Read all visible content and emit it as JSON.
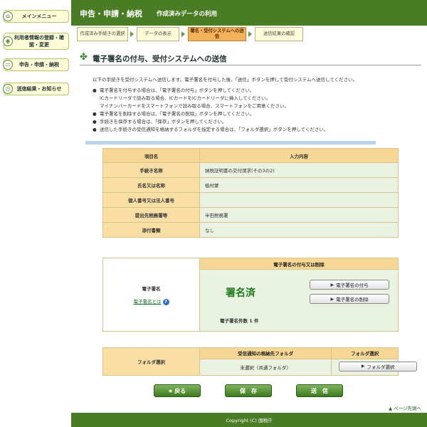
{
  "sidebar": {
    "items": [
      {
        "label": "メインメニュー"
      },
      {
        "label": "利用者情報の登録・確認・変更"
      },
      {
        "label": "申告・申請・納税"
      },
      {
        "label": "送信結果・お知らせ"
      }
    ]
  },
  "header": {
    "title": "申告・申請・納税",
    "subtitle": "作成済みデータの利用"
  },
  "steps": [
    {
      "label": "作成済み手続きの選択"
    },
    {
      "label": "データの表示"
    },
    {
      "label": "署名・受付システムへの送信"
    },
    {
      "label": "送信結果の確認"
    }
  ],
  "main": {
    "page_title": "電子署名の付与、受付システムへの送信",
    "intro": "以下の手続きを受付システムへ送信します。電子署名を付与した後、「送信」ボタンを押して受付システムへ送信してください。",
    "bullets": [
      "電子署名を付与する場合は、「電子署名の付与」ボタンを押してください。",
      "ICカードリーダで読み取る場合、ICカードをICカードリーダに挿入してください。",
      "マイナンバーカードをスマートフォンで読み取る場合、スマートフォンをご用意ください。",
      "電子署名を削除する場合は、「電子署名の削除」ボタンを押してください。",
      "手続きを保存する場合は、「保存」ボタンを押してください。",
      "送信した手続きの受信通知を格納するフォルダを指定する場合は、「フォルダ選択」ボタンを押してください。"
    ],
    "info_table": {
      "headers": [
        "項目名",
        "入力内容"
      ],
      "rows": [
        {
          "key": "手続き名称",
          "value": "納税証明書の交付請求(その3の2)"
        },
        {
          "key": "氏名又は名称",
          "value": "植村蒙"
        },
        {
          "key": "個人番号又は法人番号",
          "value": ""
        },
        {
          "key": "提出先税務署等",
          "value": "半田税務署"
        },
        {
          "key": "添付書類",
          "value": "なし"
        }
      ]
    },
    "signature": {
      "label": "電子署名",
      "help_link": "電子署名とは",
      "header": "電子署名の付与又は削除",
      "status": "署名済",
      "count": "電子署名件数 1 件",
      "add_button": "電子署名の付与",
      "delete_button": "電子署名の削除"
    },
    "folder": {
      "label": "フォルダ選択",
      "col1": "受信通知の格納先フォルダ",
      "col2": "フォルダ選択",
      "value": "未選択（共通フォルダ）",
      "button": "フォルダ選択"
    },
    "buttons": {
      "back": "戻る",
      "save": "保　存",
      "send": "送　信"
    },
    "page_top": "ページ先頭へ"
  },
  "footer": {
    "copyright": "Copyright (C) 国税庁"
  }
}
